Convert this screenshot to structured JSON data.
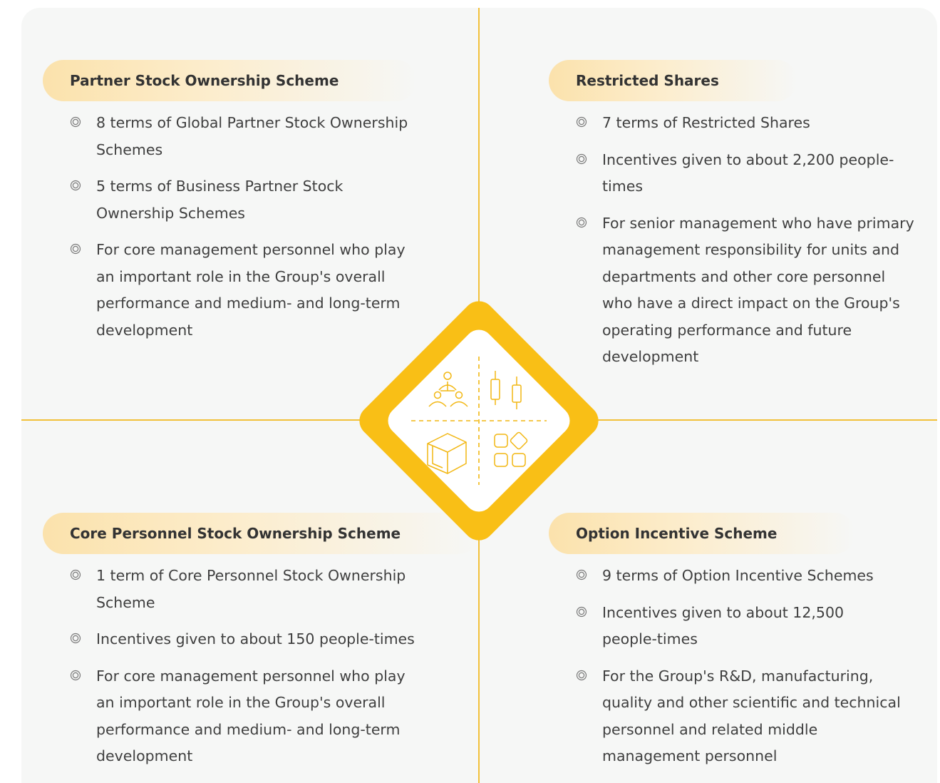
{
  "quadrants": {
    "top_left": {
      "title": "Partner Stock Ownership Scheme",
      "items": [
        "8 terms of Global Partner Stock Ownership Schemes",
        "5 terms of Business Partner Stock Ownership Schemes",
        "For core management personnel who play an important role in the Group's overall performance and medium- and long-term development"
      ]
    },
    "top_right": {
      "title": "Restricted Shares",
      "items": [
        "7 terms of Restricted Shares",
        "Incentives given to about 2,200 people-times",
        "For senior management who have primary management responsibility for units and departments and other core personnel who have a direct impact on the Group's operating performance and future development"
      ]
    },
    "bottom_left": {
      "title": "Core Personnel Stock Ownership Scheme",
      "items": [
        "1 term of Core Personnel Stock Ownership Scheme",
        "Incentives given to about 150 people-times",
        "For core management personnel who play an important role in the Group's overall performance and medium- and long-term development"
      ]
    },
    "bottom_right": {
      "title": "Option Incentive Scheme",
      "items": [
        "9 terms of Option Incentive Schemes",
        "Incentives given to about 12,500 people-times",
        "For the Group's R&D, manufacturing, quality and other scientific and technical personnel and related middle management personnel"
      ]
    }
  },
  "center_icons": [
    "people-hierarchy-icon",
    "candlestick-icon",
    "cube-icon",
    "app-grid-icon"
  ],
  "colors": {
    "accent": "#f9bf16",
    "line": "#f2c13a",
    "panel": "#f6f7f6",
    "pill_start": "#fbe2ac",
    "text": "#3f3f3f"
  }
}
